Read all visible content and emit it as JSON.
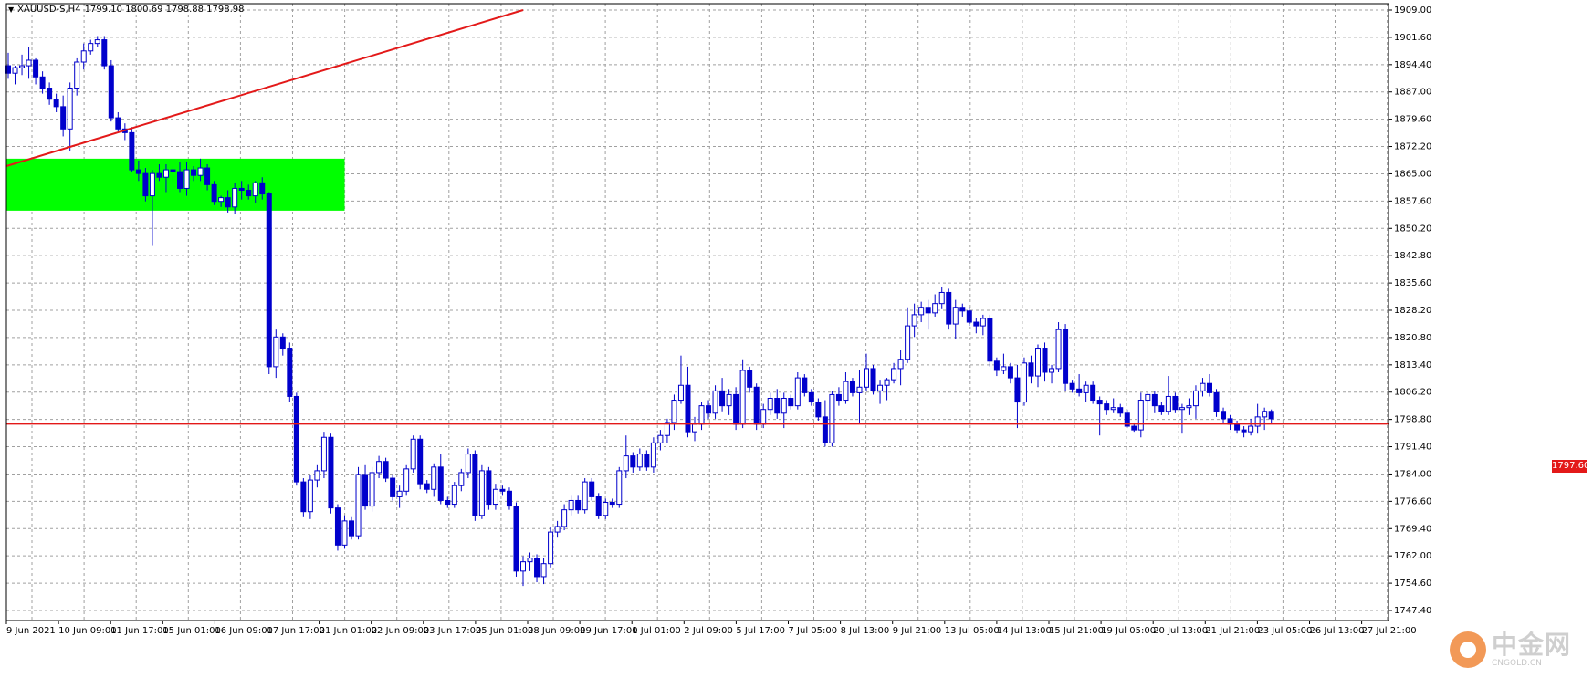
{
  "header": {
    "symbol_tf": "XAUUSD-S,H4",
    "ohlc": "1799.10 1800.69 1798.88 1798.98"
  },
  "current_price_label": "1797.60",
  "watermark": {
    "cn": "中金网",
    "en": "CNGOLD.CN"
  },
  "colors": {
    "candle": "#0000cc",
    "trendline": "#e31919",
    "zone": "#00ff00",
    "price_line": "#e31919",
    "grid": "#a0a0a0",
    "background": "#ffffff"
  },
  "chart_data": {
    "type": "candlestick",
    "symbol": "XAUUSD-S",
    "timeframe": "H4",
    "ylim": [
      1747.4,
      1909.0
    ],
    "y_ticks": [
      "1909.00",
      "1901.60",
      "1894.40",
      "1887.00",
      "1879.60",
      "1872.20",
      "1865.00",
      "1857.60",
      "1850.20",
      "1842.80",
      "1835.60",
      "1828.20",
      "1820.80",
      "1813.40",
      "1806.20",
      "1798.80",
      "1791.40",
      "1784.00",
      "1776.60",
      "1769.40",
      "1762.00",
      "1754.60",
      "1747.40"
    ],
    "x_ticks": [
      "9 Jun 2021",
      "10 Jun 09:00",
      "11 Jun 17:00",
      "15 Jun 01:00",
      "16 Jun 09:00",
      "17 Jun 17:00",
      "21 Jun 01:00",
      "22 Jun 09:00",
      "23 Jun 17:00",
      "25 Jun 01:00",
      "28 Jun 09:00",
      "29 Jun 17:00",
      "1 Jul 01:00",
      "2 Jul 09:00",
      "5 Jul 17:00",
      "7 Jul 05:00",
      "8 Jul 13:00",
      "9 Jul 21:00",
      "13 Jul 05:00",
      "14 Jul 13:00",
      "15 Jul 21:00",
      "19 Jul 05:00",
      "20 Jul 13:00",
      "21 Jul 21:00",
      "23 Jul 05:00",
      "26 Jul 13:00",
      "27 Jul 21:00"
    ],
    "current_price": 1797.6,
    "supply_zone": {
      "start_index": 0,
      "end_index": 49,
      "low": 1855.0,
      "high": 1869.0
    },
    "trendline": {
      "start_index": 0,
      "start_price": 1867.0,
      "end_index": 75,
      "end_price": 1909.0
    },
    "candles": [
      [
        1894.0,
        1897.5,
        1890.5,
        1892.0
      ],
      [
        1892.0,
        1894.0,
        1889.0,
        1893.5
      ],
      [
        1893.5,
        1897.0,
        1891.5,
        1894.0
      ],
      [
        1894.0,
        1899.0,
        1890.5,
        1895.5
      ],
      [
        1895.5,
        1896.0,
        1889.0,
        1891.0
      ],
      [
        1891.0,
        1892.5,
        1886.5,
        1888.0
      ],
      [
        1888.0,
        1889.5,
        1883.5,
        1885.0
      ],
      [
        1885.0,
        1886.5,
        1881.5,
        1883.0
      ],
      [
        1883.0,
        1886.0,
        1875.0,
        1877.0
      ],
      [
        1877.0,
        1889.5,
        1871.0,
        1888.0
      ],
      [
        1888.0,
        1896.0,
        1886.0,
        1895.0
      ],
      [
        1895.0,
        1900.0,
        1893.0,
        1898.0
      ],
      [
        1898.0,
        1901.0,
        1897.0,
        1900.0
      ],
      [
        1900.0,
        1902.0,
        1899.0,
        1901.0
      ],
      [
        1901.0,
        1902.0,
        1893.0,
        1894.0
      ],
      [
        1894.0,
        1895.5,
        1879.0,
        1880.0
      ],
      [
        1880.0,
        1881.5,
        1876.0,
        1877.0
      ],
      [
        1877.0,
        1878.5,
        1874.0,
        1876.0
      ],
      [
        1876.0,
        1877.5,
        1865.5,
        1866.0
      ],
      [
        1866.0,
        1868.5,
        1863.0,
        1865.0
      ],
      [
        1865.0,
        1866.5,
        1857.5,
        1859.0
      ],
      [
        1859.0,
        1866.0,
        1845.5,
        1865.0
      ],
      [
        1865.0,
        1867.5,
        1863.0,
        1864.0
      ],
      [
        1864.0,
        1867.5,
        1860.0,
        1866.0
      ],
      [
        1866.0,
        1867.0,
        1862.5,
        1865.5
      ],
      [
        1865.5,
        1868.0,
        1860.0,
        1861.0
      ],
      [
        1861.0,
        1868.0,
        1859.0,
        1866.0
      ],
      [
        1866.0,
        1867.0,
        1863.0,
        1864.5
      ],
      [
        1864.5,
        1869.0,
        1863.0,
        1866.5
      ],
      [
        1866.5,
        1867.5,
        1860.5,
        1862.0
      ],
      [
        1862.0,
        1863.0,
        1856.5,
        1857.5
      ],
      [
        1857.5,
        1859.0,
        1856.0,
        1858.5
      ],
      [
        1858.5,
        1860.5,
        1854.5,
        1856.0
      ],
      [
        1856.0,
        1862.5,
        1854.0,
        1861.0
      ],
      [
        1861.0,
        1863.0,
        1858.0,
        1860.5
      ],
      [
        1860.5,
        1862.0,
        1858.0,
        1859.0
      ],
      [
        1859.0,
        1863.0,
        1857.0,
        1862.5
      ],
      [
        1862.5,
        1864.0,
        1858.0,
        1859.5
      ],
      [
        1859.5,
        1860.0,
        1811.0,
        1813.0
      ],
      [
        1813.0,
        1823.0,
        1810.0,
        1821.0
      ],
      [
        1821.0,
        1822.0,
        1816.0,
        1818.0
      ],
      [
        1818.0,
        1819.5,
        1803.5,
        1805.0
      ],
      [
        1805.0,
        1806.0,
        1781.0,
        1782.0
      ],
      [
        1782.0,
        1783.0,
        1772.5,
        1774.0
      ],
      [
        1774.0,
        1784.0,
        1772.0,
        1782.5
      ],
      [
        1782.5,
        1786.5,
        1780.5,
        1785.0
      ],
      [
        1785.0,
        1795.5,
        1783.0,
        1794.0
      ],
      [
        1794.0,
        1795.0,
        1773.5,
        1775.0
      ],
      [
        1775.0,
        1776.0,
        1763.5,
        1765.0
      ],
      [
        1765.0,
        1773.0,
        1764.0,
        1771.5
      ],
      [
        1771.5,
        1772.5,
        1766.5,
        1767.5
      ],
      [
        1767.5,
        1786.0,
        1766.5,
        1784.0
      ],
      [
        1784.0,
        1786.5,
        1774.5,
        1775.5
      ],
      [
        1775.5,
        1786.0,
        1774.0,
        1784.5
      ],
      [
        1784.5,
        1789.0,
        1783.0,
        1787.5
      ],
      [
        1787.5,
        1788.5,
        1782.0,
        1783.0
      ],
      [
        1783.0,
        1784.0,
        1777.0,
        1778.0
      ],
      [
        1778.0,
        1781.0,
        1775.0,
        1779.5
      ],
      [
        1779.5,
        1786.5,
        1778.5,
        1785.5
      ],
      [
        1785.5,
        1794.5,
        1784.5,
        1793.5
      ],
      [
        1793.5,
        1794.5,
        1780.0,
        1781.5
      ],
      [
        1781.5,
        1782.5,
        1779.0,
        1780.0
      ],
      [
        1780.0,
        1787.0,
        1778.0,
        1786.0
      ],
      [
        1786.0,
        1789.5,
        1776.0,
        1777.0
      ],
      [
        1777.0,
        1778.0,
        1775.0,
        1776.0
      ],
      [
        1776.0,
        1782.0,
        1775.0,
        1781.0
      ],
      [
        1781.0,
        1785.5,
        1779.5,
        1784.5
      ],
      [
        1784.5,
        1791.0,
        1783.0,
        1789.5
      ],
      [
        1789.5,
        1790.5,
        1771.5,
        1773.0
      ],
      [
        1773.0,
        1786.5,
        1772.0,
        1785.0
      ],
      [
        1785.0,
        1786.0,
        1774.5,
        1776.0
      ],
      [
        1776.0,
        1781.5,
        1774.5,
        1780.0
      ],
      [
        1780.0,
        1781.0,
        1778.5,
        1779.5
      ],
      [
        1779.5,
        1780.5,
        1774.5,
        1775.5
      ],
      [
        1775.5,
        1776.5,
        1756.5,
        1758.0
      ],
      [
        1758.0,
        1762.0,
        1754.0,
        1760.5
      ],
      [
        1760.5,
        1763.0,
        1758.0,
        1761.5
      ],
      [
        1761.5,
        1762.5,
        1755.0,
        1756.5
      ],
      [
        1756.5,
        1761.5,
        1754.5,
        1760.0
      ],
      [
        1760.0,
        1770.0,
        1759.0,
        1768.5
      ],
      [
        1768.5,
        1771.5,
        1767.0,
        1770.0
      ],
      [
        1770.0,
        1776.0,
        1769.0,
        1774.5
      ],
      [
        1774.5,
        1778.5,
        1773.0,
        1777.0
      ],
      [
        1777.0,
        1778.5,
        1773.5,
        1774.5
      ],
      [
        1774.5,
        1783.0,
        1773.5,
        1782.0
      ],
      [
        1782.0,
        1783.0,
        1777.0,
        1778.0
      ],
      [
        1778.0,
        1779.0,
        1772.0,
        1773.0
      ],
      [
        1773.0,
        1777.5,
        1772.0,
        1776.5
      ],
      [
        1776.5,
        1777.5,
        1775.0,
        1776.0
      ],
      [
        1776.0,
        1786.0,
        1775.0,
        1785.0
      ],
      [
        1785.0,
        1794.5,
        1783.0,
        1789.0
      ],
      [
        1789.0,
        1790.0,
        1784.5,
        1786.0
      ],
      [
        1786.0,
        1791.0,
        1785.0,
        1789.5
      ],
      [
        1789.5,
        1790.5,
        1785.0,
        1786.0
      ],
      [
        1786.0,
        1794.0,
        1784.5,
        1792.5
      ],
      [
        1792.5,
        1796.0,
        1790.5,
        1794.5
      ],
      [
        1794.5,
        1799.0,
        1792.5,
        1798.0
      ],
      [
        1798.0,
        1805.5,
        1796.0,
        1804.0
      ],
      [
        1804.0,
        1816.0,
        1803.0,
        1808.0
      ],
      [
        1808.0,
        1813.0,
        1794.0,
        1795.5
      ],
      [
        1795.5,
        1799.5,
        1793.0,
        1797.5
      ],
      [
        1797.5,
        1803.5,
        1796.0,
        1802.5
      ],
      [
        1802.5,
        1804.0,
        1799.0,
        1800.5
      ],
      [
        1800.5,
        1808.0,
        1799.0,
        1806.5
      ],
      [
        1806.5,
        1810.0,
        1801.0,
        1802.5
      ],
      [
        1802.5,
        1807.0,
        1800.0,
        1805.5
      ],
      [
        1805.5,
        1807.5,
        1796.0,
        1797.5
      ],
      [
        1797.5,
        1815.0,
        1796.5,
        1812.0
      ],
      [
        1812.0,
        1813.0,
        1806.0,
        1807.5
      ],
      [
        1807.5,
        1808.5,
        1796.0,
        1797.5
      ],
      [
        1797.5,
        1803.0,
        1796.5,
        1801.5
      ],
      [
        1801.5,
        1806.0,
        1800.0,
        1804.5
      ],
      [
        1804.5,
        1807.0,
        1799.0,
        1800.5
      ],
      [
        1800.5,
        1806.0,
        1796.5,
        1804.5
      ],
      [
        1804.5,
        1805.5,
        1801.5,
        1802.5
      ],
      [
        1802.5,
        1811.5,
        1801.5,
        1810.0
      ],
      [
        1810.0,
        1811.0,
        1805.0,
        1806.0
      ],
      [
        1806.0,
        1807.0,
        1802.5,
        1803.5
      ],
      [
        1803.5,
        1804.5,
        1798.5,
        1799.5
      ],
      [
        1799.5,
        1804.0,
        1791.5,
        1792.5
      ],
      [
        1792.5,
        1806.5,
        1791.5,
        1805.5
      ],
      [
        1805.5,
        1807.5,
        1802.5,
        1804.0
      ],
      [
        1804.0,
        1811.5,
        1803.0,
        1809.0
      ],
      [
        1809.0,
        1810.0,
        1805.0,
        1806.0
      ],
      [
        1806.0,
        1812.0,
        1798.0,
        1807.5
      ],
      [
        1807.5,
        1816.5,
        1806.5,
        1812.5
      ],
      [
        1812.5,
        1813.5,
        1805.5,
        1806.5
      ],
      [
        1806.5,
        1809.5,
        1803.0,
        1808.0
      ],
      [
        1808.0,
        1810.0,
        1804.0,
        1809.5
      ],
      [
        1809.5,
        1814.0,
        1808.5,
        1812.5
      ],
      [
        1812.5,
        1817.5,
        1808.0,
        1815.0
      ],
      [
        1815.0,
        1829.0,
        1814.0,
        1824.0
      ],
      [
        1824.0,
        1830.0,
        1821.0,
        1827.0
      ],
      [
        1827.0,
        1830.5,
        1825.0,
        1829.0
      ],
      [
        1829.0,
        1831.0,
        1823.0,
        1827.5
      ],
      [
        1827.5,
        1832.5,
        1826.5,
        1830.0
      ],
      [
        1830.0,
        1834.5,
        1828.5,
        1833.0
      ],
      [
        1833.0,
        1834.0,
        1823.0,
        1824.5
      ],
      [
        1824.5,
        1831.0,
        1820.5,
        1829.0
      ],
      [
        1829.0,
        1830.0,
        1826.5,
        1828.0
      ],
      [
        1828.0,
        1829.0,
        1824.0,
        1825.0
      ],
      [
        1825.0,
        1826.0,
        1822.0,
        1824.0
      ],
      [
        1824.0,
        1827.0,
        1821.5,
        1826.0
      ],
      [
        1826.0,
        1827.0,
        1813.0,
        1814.5
      ],
      [
        1814.5,
        1815.5,
        1810.5,
        1812.0
      ],
      [
        1812.0,
        1816.5,
        1811.0,
        1813.0
      ],
      [
        1813.0,
        1814.0,
        1808.5,
        1810.0
      ],
      [
        1810.0,
        1813.5,
        1796.5,
        1803.5
      ],
      [
        1803.5,
        1815.5,
        1802.5,
        1814.0
      ],
      [
        1814.0,
        1816.0,
        1808.5,
        1810.5
      ],
      [
        1810.5,
        1819.0,
        1807.5,
        1818.0
      ],
      [
        1818.0,
        1819.5,
        1809.0,
        1811.5
      ],
      [
        1811.5,
        1813.5,
        1808.5,
        1812.5
      ],
      [
        1812.5,
        1825.0,
        1811.5,
        1823.0
      ],
      [
        1823.0,
        1824.5,
        1806.5,
        1808.5
      ],
      [
        1808.5,
        1809.5,
        1806.0,
        1807.0
      ],
      [
        1807.0,
        1811.0,
        1805.0,
        1806.0
      ],
      [
        1806.0,
        1809.0,
        1803.5,
        1808.0
      ],
      [
        1808.0,
        1809.0,
        1803.0,
        1804.0
      ],
      [
        1804.0,
        1805.0,
        1794.5,
        1803.0
      ],
      [
        1803.0,
        1804.0,
        1800.0,
        1801.5
      ],
      [
        1801.5,
        1804.5,
        1800.5,
        1802.0
      ],
      [
        1802.0,
        1803.0,
        1799.5,
        1800.5
      ],
      [
        1800.5,
        1801.5,
        1796.5,
        1797.0
      ],
      [
        1797.0,
        1798.0,
        1795.5,
        1796.0
      ],
      [
        1796.0,
        1806.0,
        1794.0,
        1804.0
      ],
      [
        1804.0,
        1806.0,
        1799.0,
        1805.5
      ],
      [
        1805.5,
        1806.5,
        1800.5,
        1802.5
      ],
      [
        1802.5,
        1803.5,
        1800.0,
        1801.0
      ],
      [
        1801.0,
        1810.5,
        1800.0,
        1805.0
      ],
      [
        1805.0,
        1806.0,
        1800.5,
        1801.5
      ],
      [
        1801.5,
        1803.0,
        1795.0,
        1802.0
      ],
      [
        1802.0,
        1804.5,
        1800.0,
        1802.5
      ],
      [
        1802.5,
        1808.0,
        1799.0,
        1806.5
      ],
      [
        1806.5,
        1810.0,
        1805.0,
        1808.5
      ],
      [
        1808.5,
        1811.0,
        1805.0,
        1806.0
      ],
      [
        1806.0,
        1807.0,
        1799.5,
        1801.0
      ],
      [
        1801.0,
        1802.0,
        1798.0,
        1799.0
      ],
      [
        1799.0,
        1800.0,
        1796.0,
        1797.5
      ],
      [
        1797.5,
        1798.5,
        1795.0,
        1796.0
      ],
      [
        1796.0,
        1797.0,
        1794.0,
        1795.5
      ],
      [
        1795.5,
        1799.0,
        1794.5,
        1797.0
      ],
      [
        1797.0,
        1803.0,
        1795.0,
        1799.5
      ],
      [
        1799.5,
        1802.0,
        1796.0,
        1801.0
      ],
      [
        1801.0,
        1801.5,
        1798.0,
        1799.0
      ]
    ]
  }
}
